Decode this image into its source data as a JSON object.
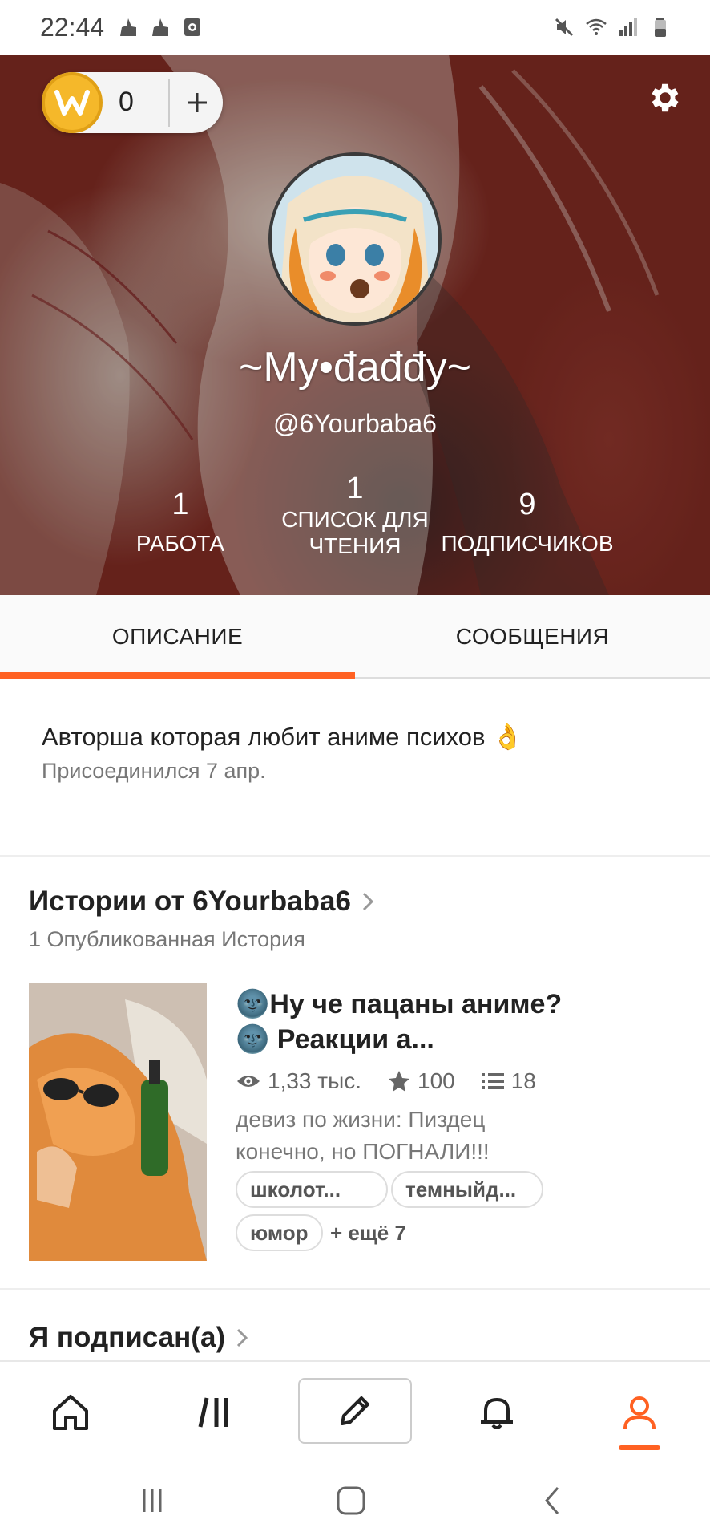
{
  "status_bar": {
    "time": "22:44",
    "left_icons": [
      "broom-icon",
      "broom-icon",
      "screen-record-icon"
    ],
    "right_icons": [
      "mute-icon",
      "wifi-icon",
      "signal-icon",
      "battery-icon"
    ]
  },
  "header": {
    "coins": "0",
    "add_label": "+",
    "display_name": "~My•đađđy~",
    "handle": "@6Yourbaba6",
    "stats": {
      "works_count": "1",
      "works_label": "РАБОТА",
      "reading_count": "1",
      "reading_label": "СПИСОК ДЛЯ ЧТЕНИЯ",
      "followers_count": "9",
      "followers_label": "ПОДПИСЧИКОВ"
    }
  },
  "tabs": {
    "about": "ОПИСАНИЕ",
    "messages": "СООБЩЕНИЯ",
    "active": "about"
  },
  "about": {
    "bio": "Авторша которая любит аниме психов 👌",
    "joined": "Присоединился 7 апр."
  },
  "stories": {
    "title": "Истории от 6Yourbaba6",
    "subtitle": "1 Опубликованная История",
    "items": [
      {
        "title": "🌚Ну че пацаны аниме?🌚 Реакции а...",
        "views": "1,33 тыс.",
        "votes": "100",
        "parts": "18",
        "description": "девиз по жизни: Пиздец конечно, но ПОГНАЛИ!!!",
        "tags": [
          "школот...",
          "темныйд...",
          "юмор"
        ],
        "more_tags": "+ ещё 7"
      }
    ]
  },
  "following": {
    "title": "Я подписан(а)"
  },
  "bottom_nav": {
    "items": [
      "home-icon",
      "library-icon",
      "write-icon",
      "notifications-icon",
      "profile-icon"
    ],
    "active": "profile-icon",
    "accent": "#ff6122"
  },
  "colors": {
    "accent": "#ff6122",
    "coin": "#f5b82a",
    "header_bg": "#7c2a22"
  }
}
